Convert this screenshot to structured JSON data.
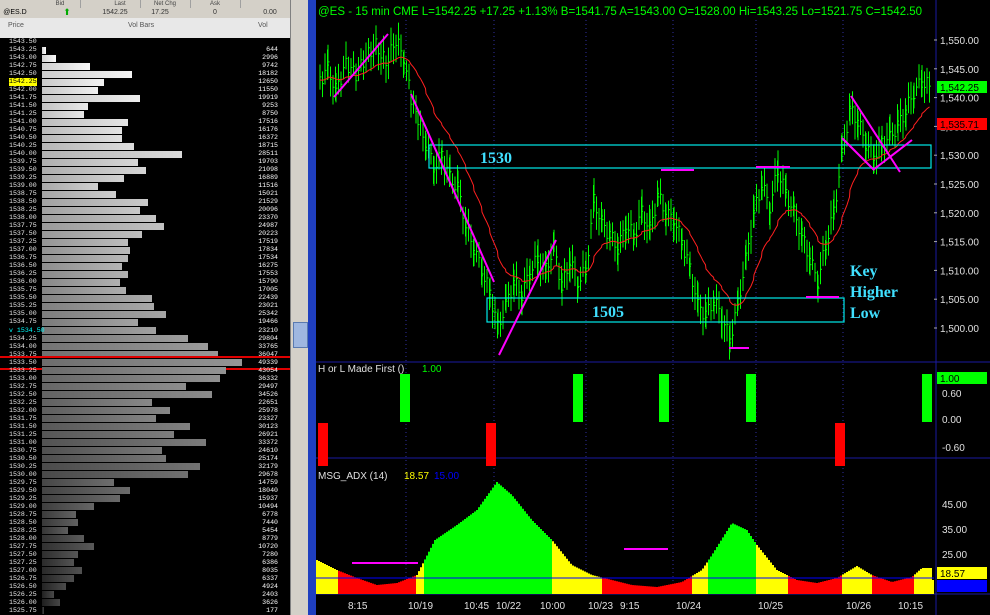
{
  "ladder": {
    "header": {
      "cells": [
        "Bid",
        "Last",
        "Net Chg",
        "Ask"
      ],
      "symbol": "@ES.D",
      "last": "1542.25",
      "net": "17.25",
      "zero1": "0",
      "zero2": "0.00"
    },
    "col_price": "Price",
    "col_volbars": "Vol Bars",
    "col_vol": "Vol",
    "rows": [
      {
        "p": "1543.50",
        "v": "",
        "w": 0
      },
      {
        "p": "1543.25",
        "v": "644",
        "w": 0.02
      },
      {
        "p": "1543.00",
        "v": "2996",
        "w": 0.07
      },
      {
        "p": "1542.75",
        "v": "9742",
        "w": 0.24
      },
      {
        "p": "1542.50",
        "v": "18182",
        "w": 0.45
      },
      {
        "p": "1542.25",
        "v": "12650",
        "w": 0.31,
        "hl": "yellow"
      },
      {
        "p": "1542.00",
        "v": "11550",
        "w": 0.28
      },
      {
        "p": "1541.75",
        "v": "19919",
        "w": 0.49
      },
      {
        "p": "1541.50",
        "v": "9253",
        "w": 0.23
      },
      {
        "p": "1541.25",
        "v": "8750",
        "w": 0.21
      },
      {
        "p": "1541.00",
        "v": "17516",
        "w": 0.43
      },
      {
        "p": "1540.75",
        "v": "16176",
        "w": 0.4
      },
      {
        "p": "1540.50",
        "v": "16372",
        "w": 0.4
      },
      {
        "p": "1540.25",
        "v": "18715",
        "w": 0.46
      },
      {
        "p": "1540.00",
        "v": "28511",
        "w": 0.7
      },
      {
        "p": "1539.75",
        "v": "19703",
        "w": 0.48
      },
      {
        "p": "1539.50",
        "v": "21098",
        "w": 0.52
      },
      {
        "p": "1539.25",
        "v": "16889",
        "w": 0.41
      },
      {
        "p": "1539.00",
        "v": "11516",
        "w": 0.28
      },
      {
        "p": "1538.75",
        "v": "15021",
        "w": 0.37
      },
      {
        "p": "1538.50",
        "v": "21529",
        "w": 0.53
      },
      {
        "p": "1538.25",
        "v": "20096",
        "w": 0.49
      },
      {
        "p": "1538.00",
        "v": "23370",
        "w": 0.57
      },
      {
        "p": "1537.75",
        "v": "24987",
        "w": 0.61
      },
      {
        "p": "1537.50",
        "v": "20223",
        "w": 0.5
      },
      {
        "p": "1537.25",
        "v": "17519",
        "w": 0.43
      },
      {
        "p": "1537.00",
        "v": "17834",
        "w": 0.44
      },
      {
        "p": "1536.75",
        "v": "17534",
        "w": 0.43
      },
      {
        "p": "1536.50",
        "v": "16275",
        "w": 0.4
      },
      {
        "p": "1536.25",
        "v": "17553",
        "w": 0.43
      },
      {
        "p": "1536.00",
        "v": "15790",
        "w": 0.39
      },
      {
        "p": "1535.75",
        "v": "17005",
        "w": 0.42
      },
      {
        "p": "1535.50",
        "v": "22439",
        "w": 0.55
      },
      {
        "p": "1535.25",
        "v": "23021",
        "w": 0.56
      },
      {
        "p": "1535.00",
        "v": "25342",
        "w": 0.62
      },
      {
        "p": "1534.75",
        "v": "19466",
        "w": 0.48
      },
      {
        "p": "v 1534.50",
        "v": "23210",
        "w": 0.57,
        "hl": "cyan"
      },
      {
        "p": "1534.25",
        "v": "29804",
        "w": 0.73
      },
      {
        "p": "1534.00",
        "v": "33765",
        "w": 0.83
      },
      {
        "p": "1533.75",
        "v": "36047",
        "w": 0.88
      },
      {
        "p": "1533.50",
        "v": "49339",
        "w": 1.0,
        "hl": "red"
      },
      {
        "p": "1533.25",
        "v": "43054",
        "w": 0.92
      },
      {
        "p": "1533.00",
        "v": "36332",
        "w": 0.89
      },
      {
        "p": "1532.75",
        "v": "29497",
        "w": 0.72
      },
      {
        "p": "1532.50",
        "v": "34526",
        "w": 0.85
      },
      {
        "p": "1532.25",
        "v": "22651",
        "w": 0.55
      },
      {
        "p": "1532.00",
        "v": "25978",
        "w": 0.64
      },
      {
        "p": "1531.75",
        "v": "23327",
        "w": 0.57
      },
      {
        "p": "1531.50",
        "v": "30123",
        "w": 0.74
      },
      {
        "p": "1531.25",
        "v": "26921",
        "w": 0.66
      },
      {
        "p": "1531.00",
        "v": "33372",
        "w": 0.82
      },
      {
        "p": "1530.75",
        "v": "24610",
        "w": 0.6
      },
      {
        "p": "1530.50",
        "v": "25174",
        "w": 0.62
      },
      {
        "p": "1530.25",
        "v": "32179",
        "w": 0.79
      },
      {
        "p": "1530.00",
        "v": "29678",
        "w": 0.73
      },
      {
        "p": "1529.75",
        "v": "14759",
        "w": 0.36
      },
      {
        "p": "1529.50",
        "v": "18040",
        "w": 0.44
      },
      {
        "p": "1529.25",
        "v": "15937",
        "w": 0.39
      },
      {
        "p": "1529.00",
        "v": "10494",
        "w": 0.26
      },
      {
        "p": "1528.75",
        "v": "6778",
        "w": 0.17
      },
      {
        "p": "1528.50",
        "v": "7440",
        "w": 0.18
      },
      {
        "p": "1528.25",
        "v": "5454",
        "w": 0.13
      },
      {
        "p": "1528.00",
        "v": "8779",
        "w": 0.21
      },
      {
        "p": "1527.75",
        "v": "10720",
        "w": 0.26
      },
      {
        "p": "1527.50",
        "v": "7280",
        "w": 0.18
      },
      {
        "p": "1527.25",
        "v": "6386",
        "w": 0.16
      },
      {
        "p": "1527.00",
        "v": "8035",
        "w": 0.2
      },
      {
        "p": "1526.75",
        "v": "6337",
        "w": 0.16
      },
      {
        "p": "1526.50",
        "v": "4924",
        "w": 0.12
      },
      {
        "p": "1526.25",
        "v": "2403",
        "w": 0.06
      },
      {
        "p": "1526.00",
        "v": "3626",
        "w": 0.09
      },
      {
        "p": "1525.75",
        "v": "177",
        "w": 0.01
      }
    ]
  },
  "chart": {
    "header": "@ES - 15 min   CME  L=1542.25  +17.25  +1.13%  B=1541.75  A=1543.00  O=1528.00  Hi=1543.25  Lo=1521.75  C=1542.50",
    "price_axis": [
      "1,550.00",
      "1,545.00",
      "1,540.00",
      "1,535.00",
      "1,530.00",
      "1,525.00",
      "1,520.00",
      "1,515.00",
      "1,510.00",
      "1,505.00",
      "1,500.00"
    ],
    "last_tag": "1,542.25",
    "ma_tag": "1,535.71",
    "box_upper_label": "1530",
    "box_lower_label": "1505",
    "annotation": [
      "Key",
      "Higher",
      "Low"
    ],
    "ind1": {
      "title": "H or L Made First  ()",
      "value": "1.00",
      "axis": [
        "0.60",
        "0.00",
        "-0.60"
      ],
      "tag": "1.00"
    },
    "ind2": {
      "title": "MSG_ADX  (14)",
      "value1": "18.57",
      "value2": "15.00",
      "axis": [
        "45.00",
        "35.00",
        "25.00"
      ],
      "tag": "18.57"
    },
    "time_axis": [
      "8:15",
      "10/19",
      "10:45",
      "10/22",
      "10:00",
      "10/23",
      "9:15",
      "10/24",
      "10/25",
      "10/26",
      "10:15"
    ],
    "colors": {
      "up": "#00ff00",
      "down": "#ff0000",
      "cyan": "#00ffff",
      "magenta": "#ff00ff",
      "yellow": "#ffff00",
      "blue": "#0000ff"
    }
  }
}
